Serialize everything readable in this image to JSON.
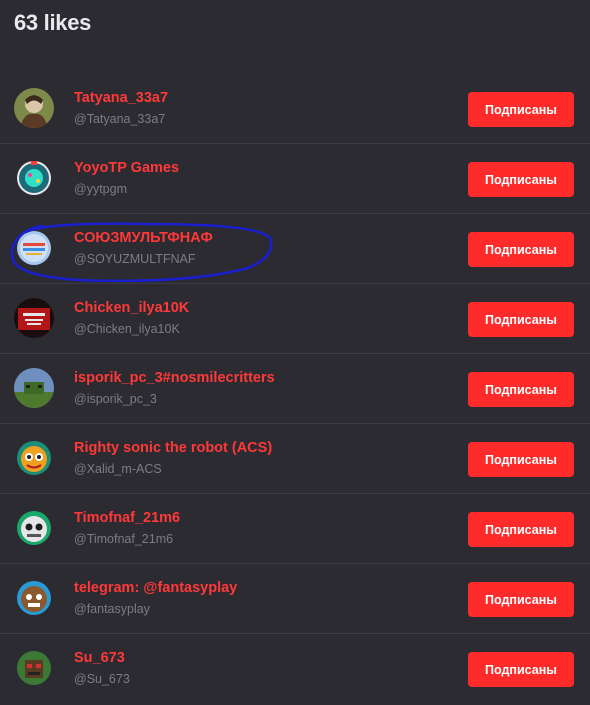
{
  "header": {
    "title": "63 likes"
  },
  "users": [
    {
      "name": "Tatyana_33a7",
      "handle": "@Tatyana_33a7",
      "button": "Подписаны",
      "avatar": "avatar-icon"
    },
    {
      "name": "YoyoTP Games",
      "handle": "@yytpgm",
      "button": "Подписаны",
      "avatar": "avatar-icon"
    },
    {
      "name": "СОЮЗМУЛЬТФНАФ",
      "handle": "@SOYUZMULTFNAF",
      "button": "Подписаны",
      "avatar": "avatar-icon"
    },
    {
      "name": "Chicken_ilya10K",
      "handle": "@Chicken_ilya10K",
      "button": "Подписаны",
      "avatar": "avatar-icon"
    },
    {
      "name": "isporik_pc_3#nosmilecritters",
      "handle": "@isporik_pc_3",
      "button": "Подписаны",
      "avatar": "avatar-icon"
    },
    {
      "name": "Righty sonic the robot (ACS)",
      "handle": "@Xalid_m-ACS",
      "button": "Подписаны",
      "avatar": "avatar-icon"
    },
    {
      "name": "Timofnaf_21m6",
      "handle": "@Timofnaf_21m6",
      "button": "Подписаны",
      "avatar": "avatar-icon"
    },
    {
      "name": "telegram: @fantasyplay",
      "handle": "@fantasyplay",
      "button": "Подписаны",
      "avatar": "avatar-icon"
    },
    {
      "name": "Su_673",
      "handle": "@Su_673",
      "button": "Подписаны",
      "avatar": "avatar-icon"
    }
  ],
  "colors": {
    "background": "#2b2b31",
    "accent": "#ff2b2b",
    "name_text": "#ff3838",
    "handle_text": "#7c7c86",
    "highlight_circle": "#1a1fd0"
  }
}
